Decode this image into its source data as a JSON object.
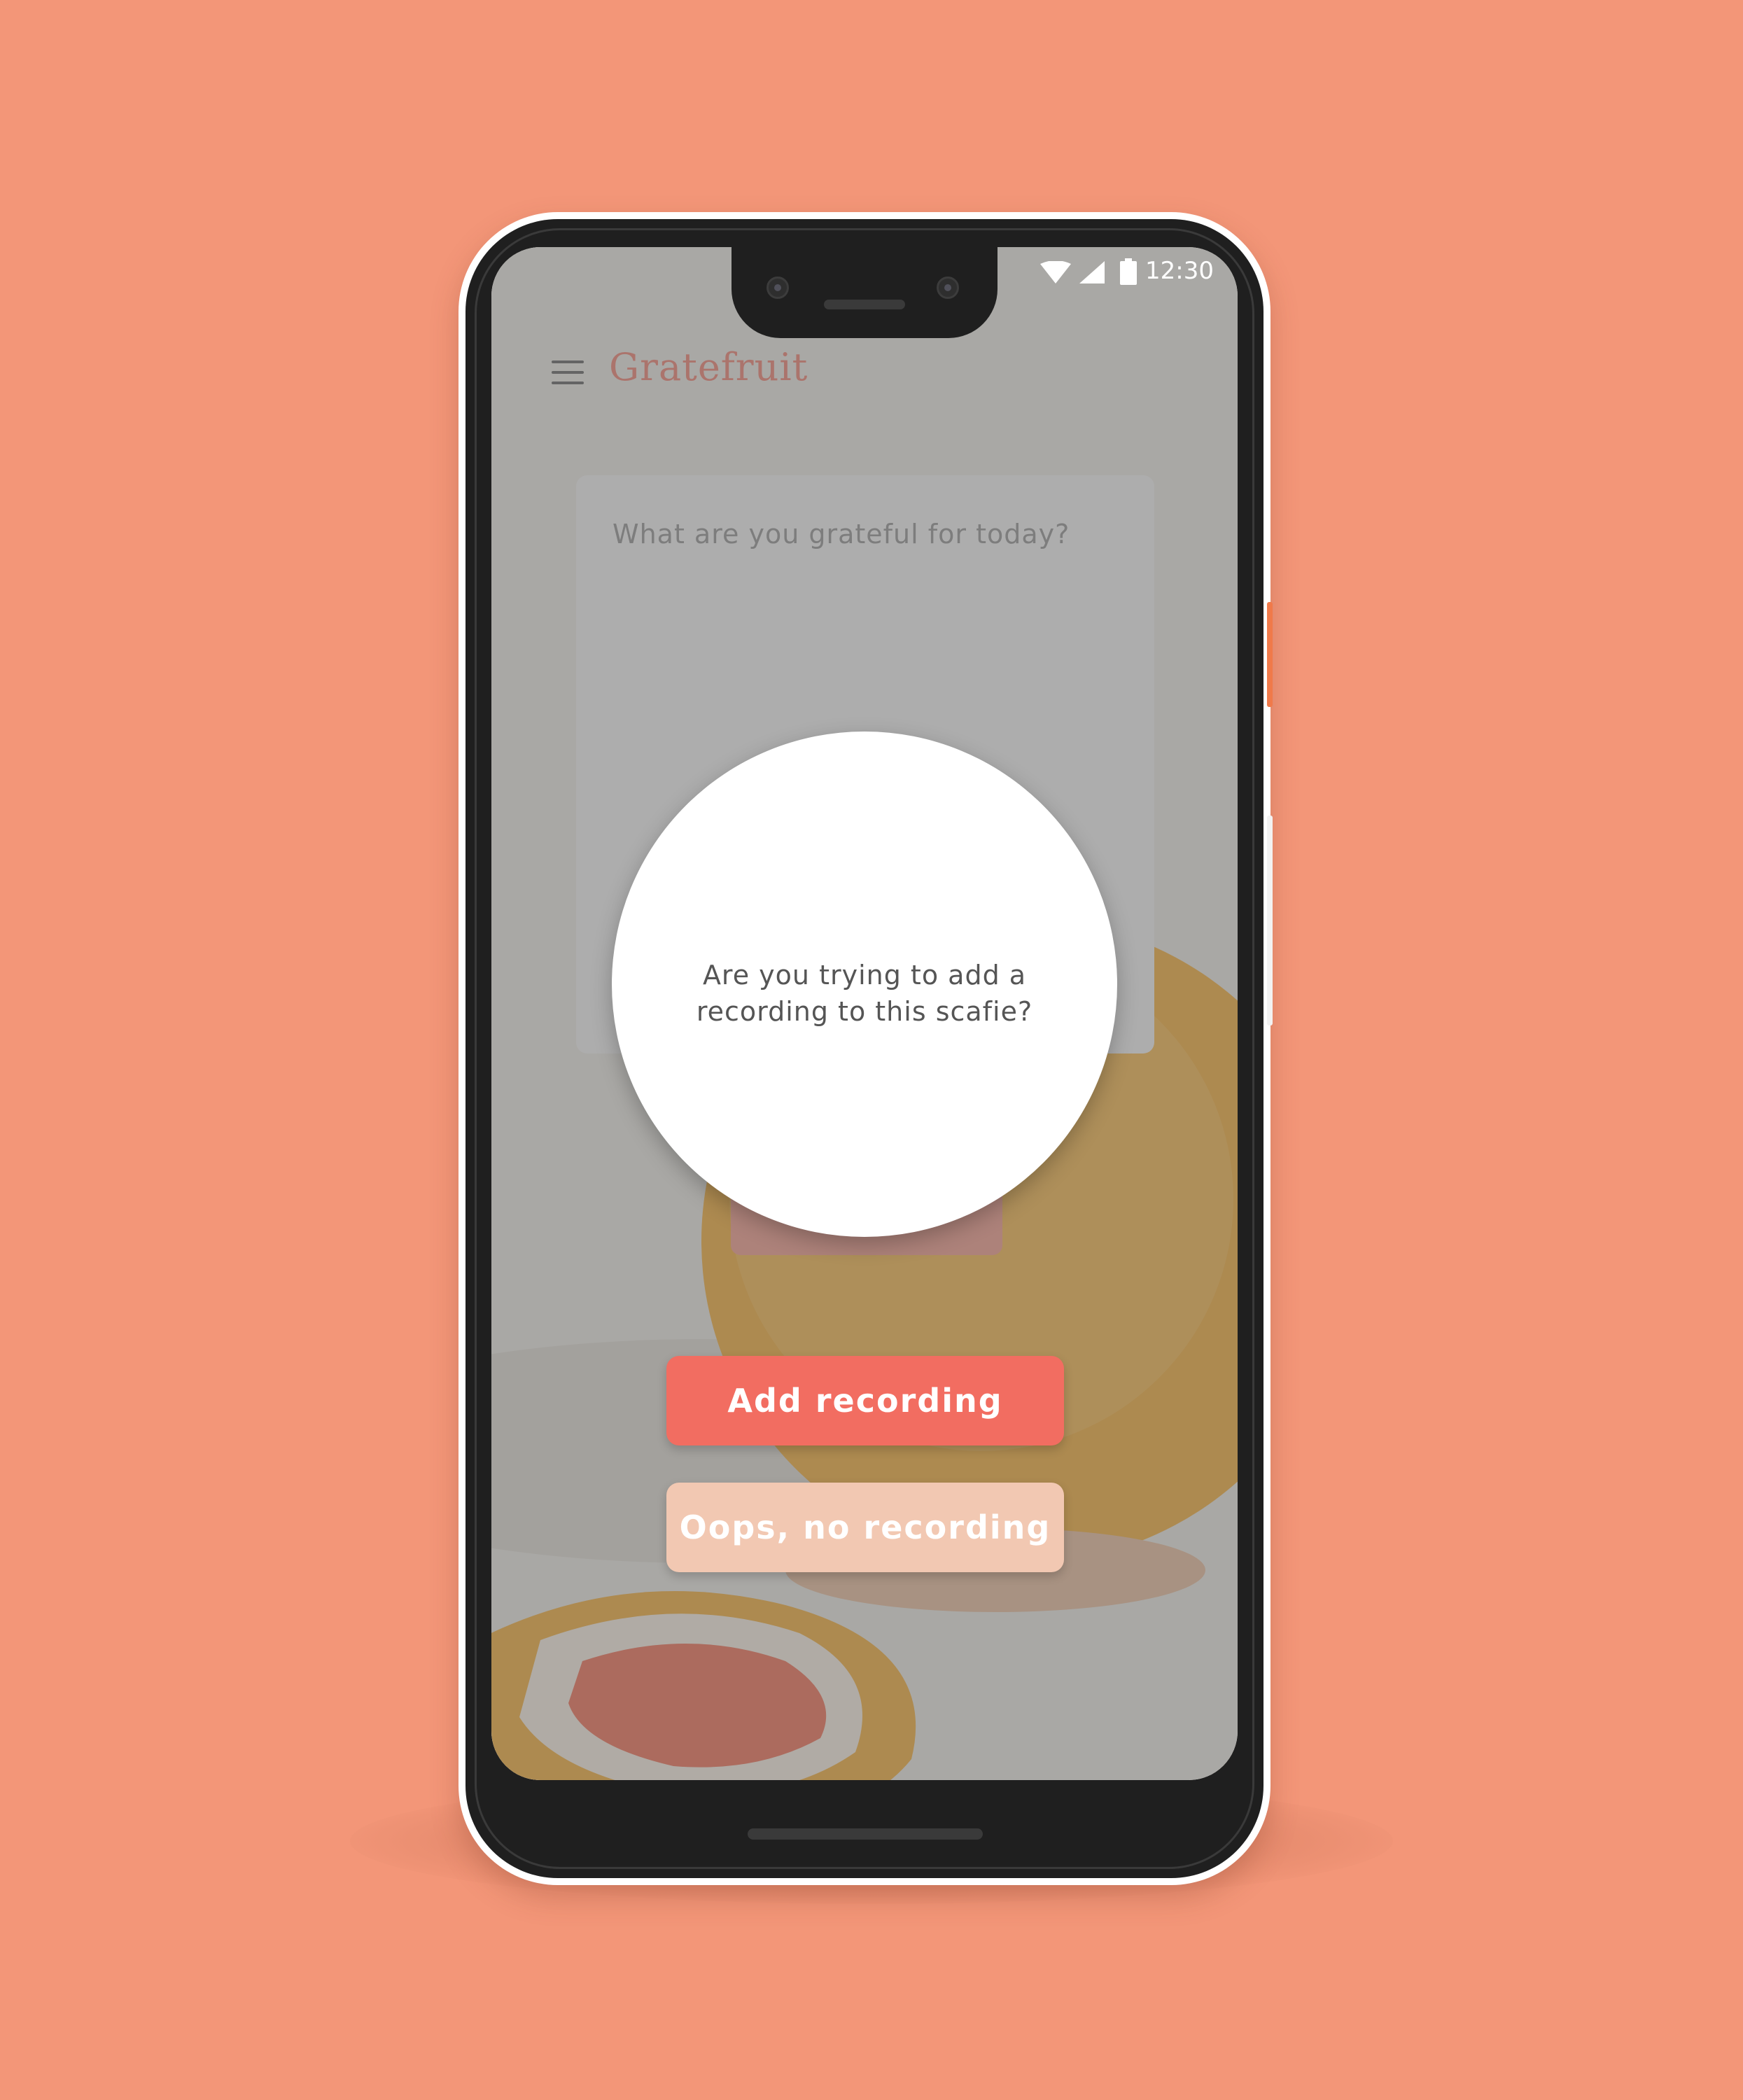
{
  "colors": {
    "background": "#F39678",
    "primary_button": "#F26D61",
    "secondary_button": "#F2C8B2",
    "brand_title": "#EF8A7D"
  },
  "status_bar": {
    "time": "12:30",
    "icons": [
      "wifi-icon",
      "signal-icon",
      "battery-icon"
    ]
  },
  "header": {
    "menu_icon": "hamburger-icon",
    "app_title": "Gratefruit"
  },
  "journal": {
    "placeholder": "What are you grateful for today?"
  },
  "dialog": {
    "message": "Are you trying to add a recording to this scafie?"
  },
  "actions": {
    "primary_label": "Add recording",
    "secondary_label": "Oops, no recording"
  }
}
